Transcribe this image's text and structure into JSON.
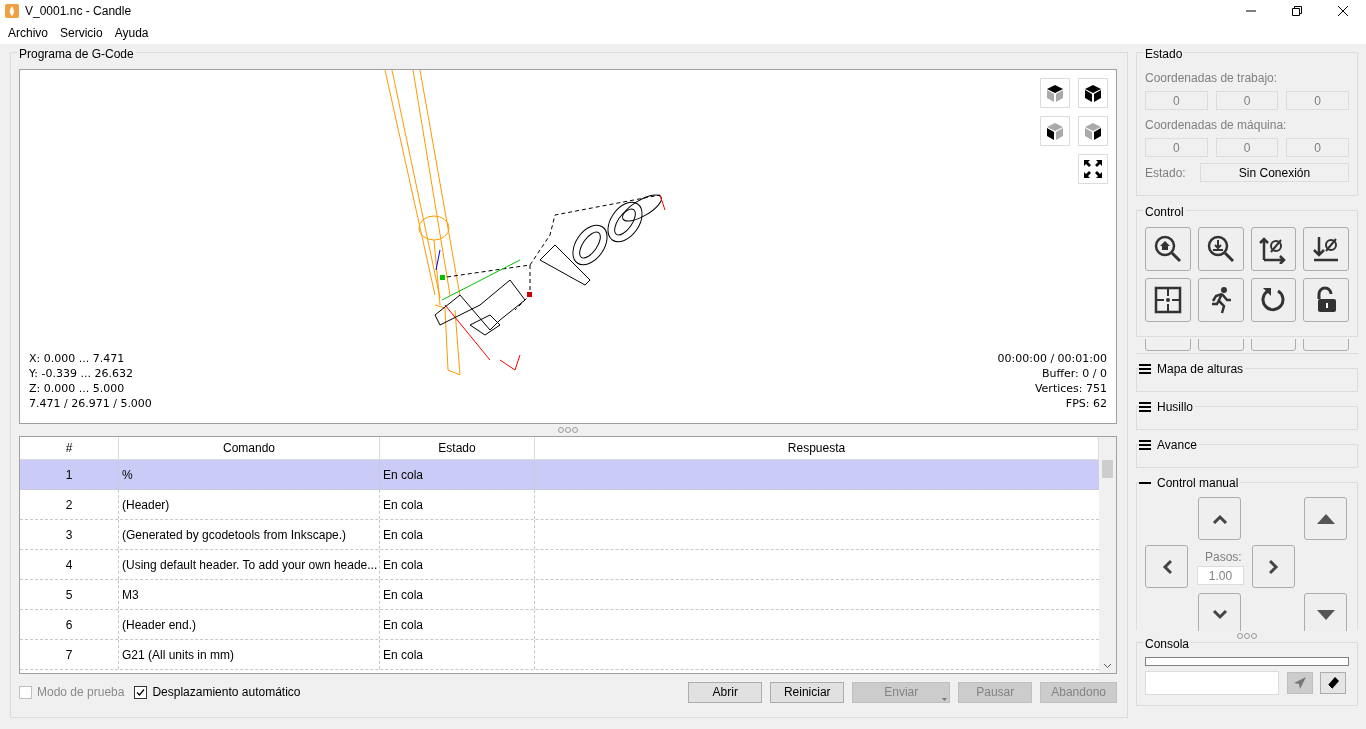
{
  "window": {
    "title": "V_0001.nc - Candle"
  },
  "menu": [
    "Archivo",
    "Servicio",
    "Ayuda"
  ],
  "gcode": {
    "title": "Programa de G-Code",
    "info_left": [
      "X: 0.000 ... 7.471",
      "Y: -0.339 ... 26.632",
      "Z: 0.000 ... 5.000",
      "7.471 / 26.971 / 5.000"
    ],
    "info_right": [
      "00:00:00 / 00:01:00",
      "Buffer: 0 / 0",
      "Vertices: 751",
      "FPS: 62"
    ],
    "table": {
      "columns": [
        "#",
        "Comando",
        "Estado",
        "Respuesta"
      ],
      "rows": [
        {
          "number": "1",
          "command": "%",
          "status": "En cola",
          "selected": true
        },
        {
          "number": "2",
          "command": "(Header)",
          "status": "En cola",
          "selected": false
        },
        {
          "number": "3",
          "command": "(Generated by gcodetools from Inkscape.)",
          "status": "En cola",
          "selected": false
        },
        {
          "number": "4",
          "command": "(Using default header. To add your own heade...",
          "status": "En cola",
          "selected": false
        },
        {
          "number": "5",
          "command": "M3",
          "status": "En cola",
          "selected": false
        },
        {
          "number": "6",
          "command": "(Header end.)",
          "status": "En cola",
          "selected": false
        },
        {
          "number": "7",
          "command": "G21 (All units in mm)",
          "status": "En cola",
          "selected": false
        }
      ]
    },
    "checkboxes": [
      {
        "label": "Modo de prueba",
        "checked": false,
        "disabled": true
      },
      {
        "label": "Desplazamiento automático",
        "checked": true,
        "disabled": false
      }
    ],
    "buttons": [
      {
        "label": "Abrir",
        "disabled": false
      },
      {
        "label": "Reiniciar",
        "disabled": false
      },
      {
        "label": "Enviar",
        "disabled": true,
        "kind": "dropdown"
      },
      {
        "label": "Pausar",
        "disabled": true
      },
      {
        "label": "Abandono",
        "disabled": true
      }
    ]
  },
  "state": {
    "title": "Estado",
    "work_label": "Coordenadas de trabajo:",
    "work": [
      "0",
      "0",
      "0"
    ],
    "machine_label": "Coordenadas de máquina:",
    "machine": [
      "0",
      "0",
      "0"
    ],
    "status_label": "Estado:",
    "status_value": "Sin Conexión"
  },
  "control": {
    "title": "Control"
  },
  "sections": [
    {
      "title": "Mapa de alturas",
      "expanded": false
    },
    {
      "title": "Husillo",
      "expanded": false
    },
    {
      "title": "Avance",
      "expanded": false
    },
    {
      "title": "Control manual",
      "expanded": true
    }
  ],
  "jog": {
    "steps_label": "Pasos:",
    "steps_value": "1.00"
  },
  "console": {
    "title": "Consola"
  }
}
